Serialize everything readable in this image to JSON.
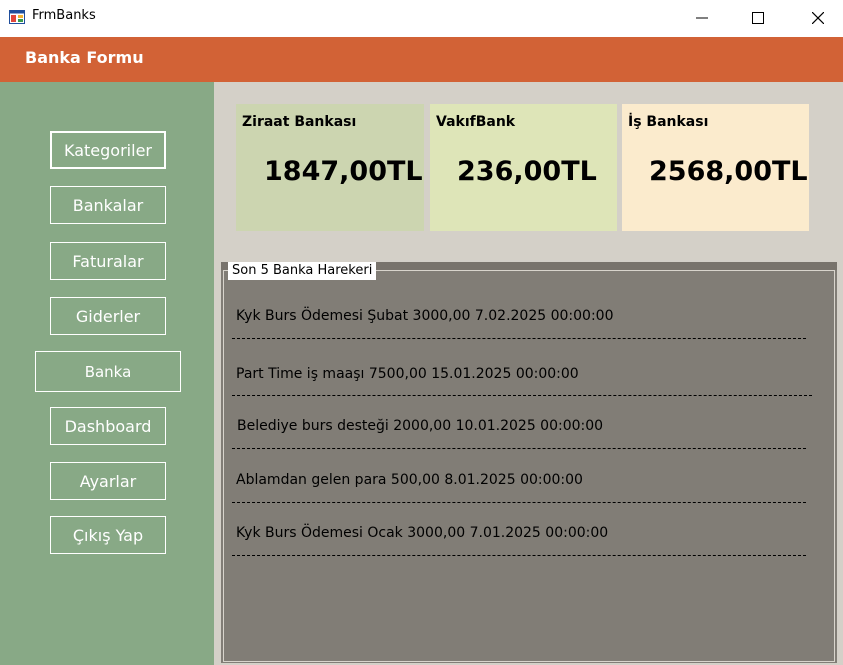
{
  "window": {
    "title": "FrmBanks",
    "minimize_glyph": "—",
    "maximize_glyph": "☐",
    "close_glyph": "✕"
  },
  "header": {
    "title": "Banka Formu"
  },
  "sidebar": {
    "items": [
      {
        "label": "Kategoriler"
      },
      {
        "label": "Bankalar"
      },
      {
        "label": "Faturalar"
      },
      {
        "label": "Giderler"
      },
      {
        "label": "Banka"
      },
      {
        "label": "Dashboard"
      },
      {
        "label": "Ayarlar"
      },
      {
        "label": "Çıkış Yap"
      }
    ]
  },
  "cards": [
    {
      "name": "Ziraat Bankası",
      "amount": "1847,00TL",
      "color": "#ccd5b0"
    },
    {
      "name": "VakıfBank",
      "amount": "236,00TL",
      "color": "#dee5b8"
    },
    {
      "name": "İş Bankası",
      "amount": "2568,00TL",
      "color": "#fbebcd"
    }
  ],
  "transactions": {
    "legend": "Son 5 Banka Harekeri",
    "items": [
      "Kyk Burs Ödemesi Şubat 3000,00 7.02.2025 00:00:00",
      "Part Time iş maaşı 7500,00 15.01.2025 00:00:00",
      "Belediye burs desteği 2000,00 10.01.2025 00:00:00",
      "Ablamdan gelen para 500,00 8.01.2025 00:00:00",
      "Kyk Burs Ödemesi Ocak 3000,00 7.01.2025 00:00:00"
    ]
  },
  "colors": {
    "header": "#d26236",
    "sidebar": "#88a986",
    "main_bg": "#d4d0c8",
    "group_bg": "#817d76"
  }
}
